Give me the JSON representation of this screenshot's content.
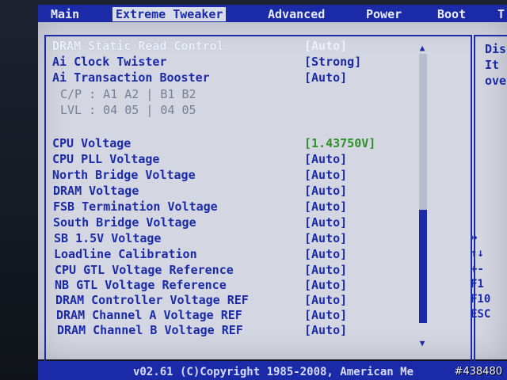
{
  "menu": [
    {
      "label": "Main"
    },
    {
      "label": "Extreme Tweaker"
    },
    {
      "label": "Advanced"
    },
    {
      "label": "Power"
    },
    {
      "label": "Boot"
    },
    {
      "label": "T"
    }
  ],
  "settings_top": [
    {
      "label": "DRAM Static Read Control",
      "value": "[Auto]"
    },
    {
      "label": "Ai Clock Twister",
      "value": "[Strong]"
    },
    {
      "label": "Ai Transaction Booster",
      "value": "[Auto]"
    }
  ],
  "info_rows": [
    {
      "text": "C/P : A1 A2 | B1 B2"
    },
    {
      "text": "LVL : 04 05 | 04 05"
    }
  ],
  "settings_voltage": [
    {
      "label": "CPU Voltage",
      "value": "[1.43750V]"
    },
    {
      "label": "CPU PLL Voltage",
      "value": "[Auto]"
    },
    {
      "label": "North Bridge Voltage",
      "value": "[Auto]"
    },
    {
      "label": "DRAM Voltage",
      "value": "[Auto]"
    },
    {
      "label": "FSB Termination Voltage",
      "value": "[Auto]"
    },
    {
      "label": "South Bridge Voltage",
      "value": "[Auto]"
    },
    {
      "label": "SB 1.5V Voltage",
      "value": "[Auto]"
    },
    {
      "label": "Loadline Calibration",
      "value": "[Auto]"
    },
    {
      "label": "CPU GTL Voltage Reference",
      "value": "[Auto]"
    },
    {
      "label": "NB GTL Voltage Reference",
      "value": "[Auto]"
    },
    {
      "label": "DRAM Controller Voltage REF",
      "value": "[Auto]"
    },
    {
      "label": "DRAM Channel A Voltage REF",
      "value": "[Auto]"
    },
    {
      "label": "DRAM Channel B Voltage REF",
      "value": "[Auto]"
    }
  ],
  "help": [
    "Dis",
    "It",
    "ove"
  ],
  "keys": [
    "↔",
    "↑↓",
    "+-",
    "F1",
    "F10",
    "ESC"
  ],
  "scrollbar": {
    "position": 0.58
  },
  "footer": {
    "text": "v02.61 (C)Copyright 1985-2008, American Me"
  },
  "watermark": "#438480"
}
